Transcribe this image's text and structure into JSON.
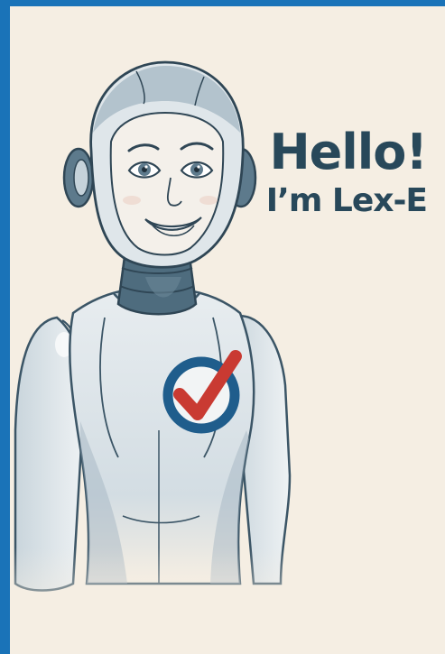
{
  "greeting": {
    "line1": "Hello!",
    "line2": "I’m Lex-E"
  },
  "illustration": {
    "subject": "robot-mascot",
    "chest_emblem": "checkmark-icon"
  },
  "colors": {
    "frame_border": "#1a73b8",
    "background": "#f5eee3",
    "text": "#28485a",
    "emblem_ring": "#1f5d8c",
    "emblem_check": "#c93a32",
    "line": "#3b5566"
  }
}
